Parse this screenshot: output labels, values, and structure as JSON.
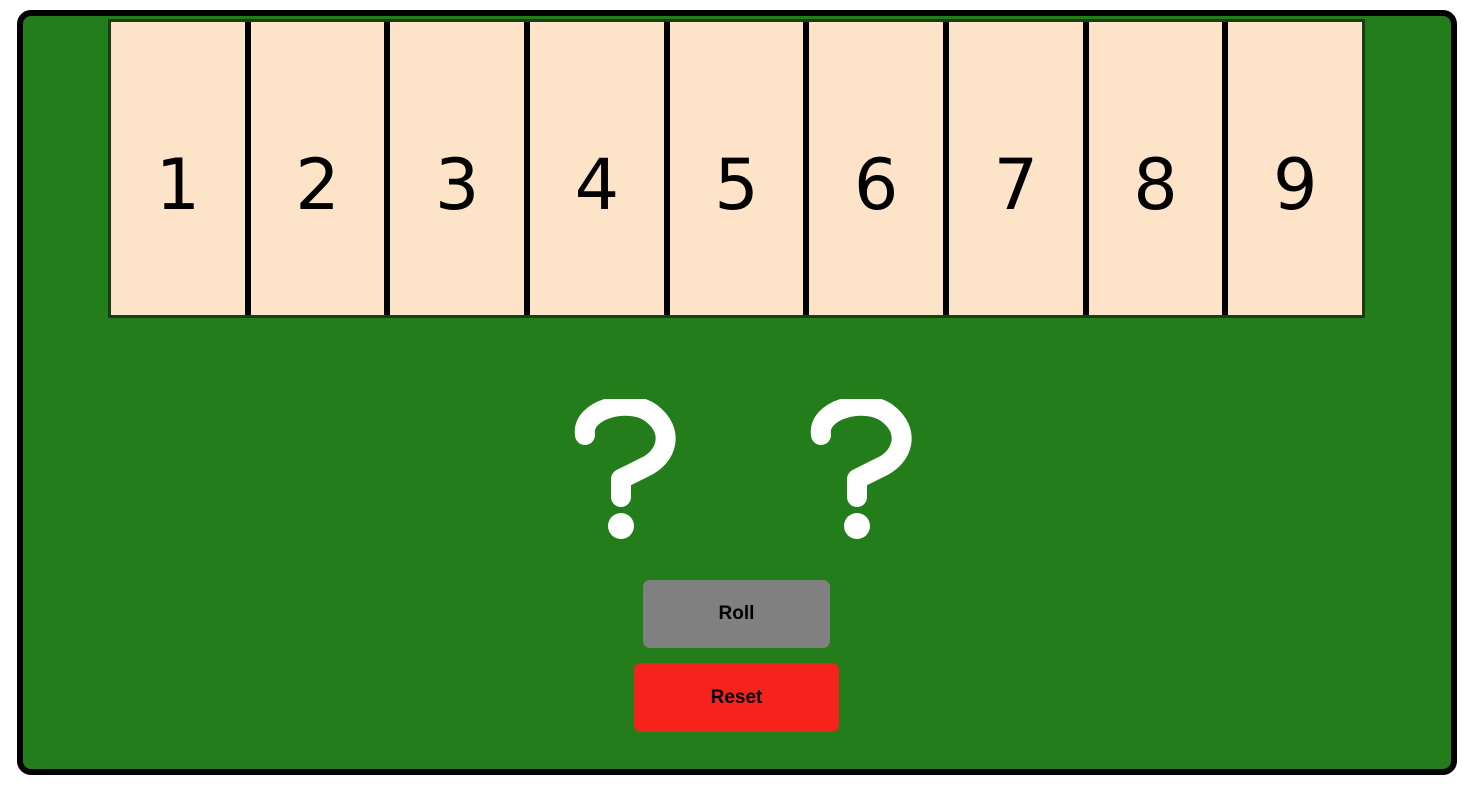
{
  "board": {
    "colors": {
      "felt": "#247d1b",
      "tile": "#fde4c8",
      "border": "#000000",
      "roll_button": "#808080",
      "reset_button": "#f5231c"
    }
  },
  "tiles": [
    "1",
    "2",
    "3",
    "4",
    "5",
    "6",
    "7",
    "8",
    "9"
  ],
  "dice": {
    "die1": {
      "icon": "question-mark-icon"
    },
    "die2": {
      "icon": "question-mark-icon"
    }
  },
  "controls": {
    "roll_label": "Roll",
    "reset_label": "Reset"
  }
}
